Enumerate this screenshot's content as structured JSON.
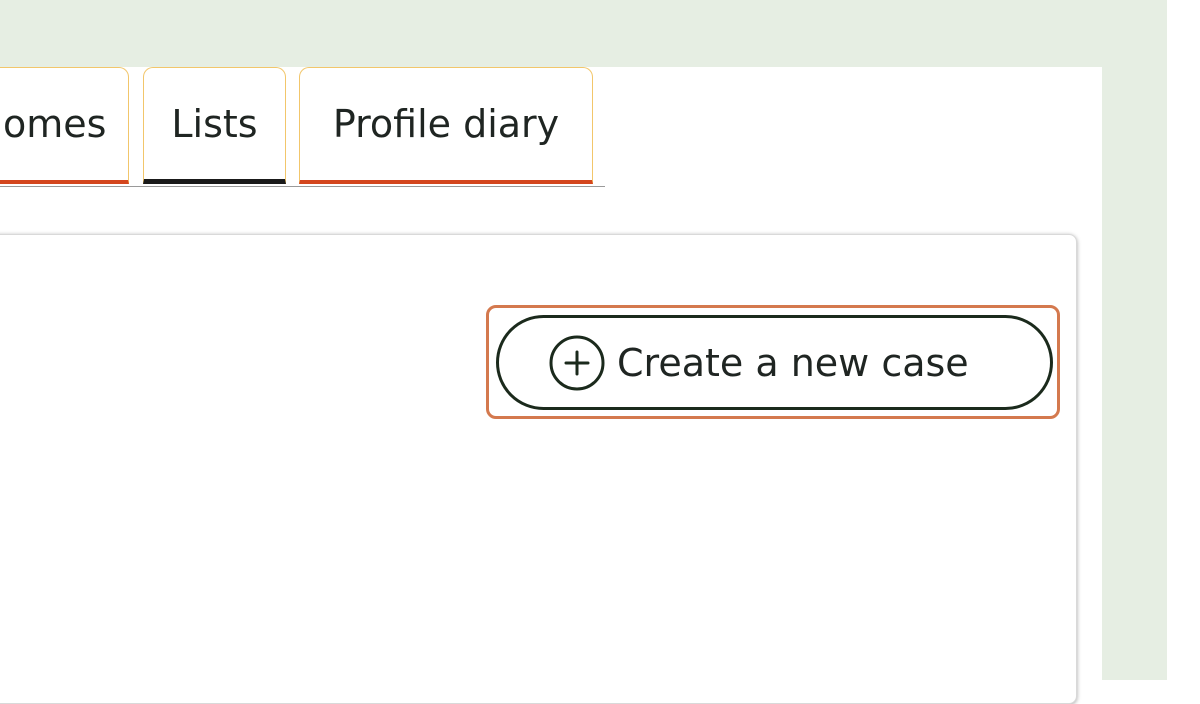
{
  "tabs": [
    {
      "label": "omes",
      "state": "inactive"
    },
    {
      "label": "Lists",
      "state": "active"
    },
    {
      "label": "Profile diary",
      "state": "inactive"
    }
  ],
  "actions": {
    "create_case_label": "Create a new case",
    "create_case_icon": "plus-circle-icon"
  },
  "colors": {
    "page_background": "#e6eee3",
    "tab_border": "#f2c66b",
    "tab_underline_inactive": "#d4461e",
    "tab_underline_active": "#1a1a1a",
    "button_border": "#1b2a1c",
    "highlight_outline": "#d4794e"
  }
}
